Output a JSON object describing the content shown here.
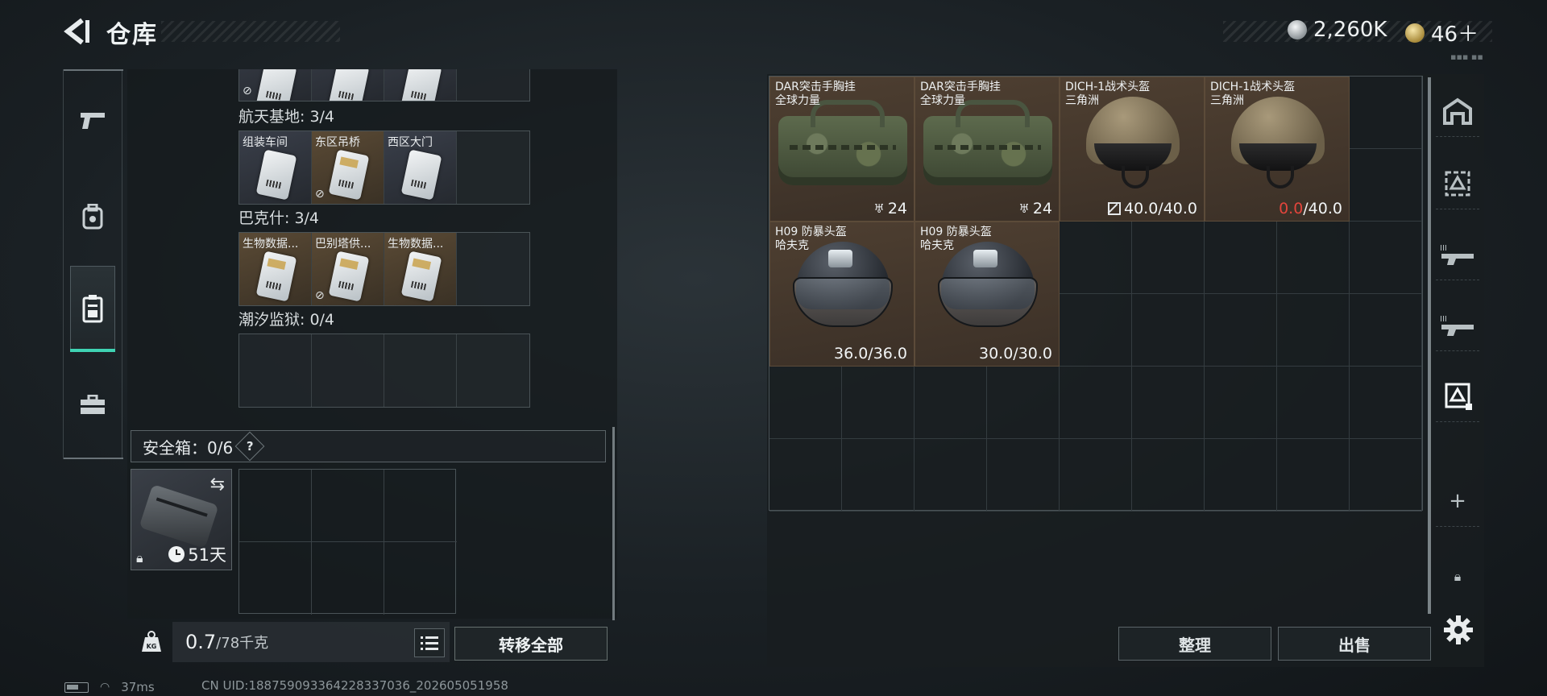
{
  "header": {
    "title": "仓库"
  },
  "currency": [
    {
      "icon": "silver-coin-icon",
      "value": "2,260K"
    },
    {
      "icon": "gold-coin-icon",
      "value": "46＋"
    }
  ],
  "left_nav": [
    "gun-icon",
    "backpack-icon",
    "container-icon",
    "toolbox-icon"
  ],
  "key_sections": [
    {
      "label": "航天基地: 3/4",
      "cards": [
        {
          "name": "组装车间",
          "tier": "silver",
          "locked": false
        },
        {
          "name": "东区吊桥",
          "tier": "gold",
          "locked": true
        },
        {
          "name": "西区大门",
          "tier": "silver",
          "locked": false
        },
        null
      ]
    },
    {
      "label": "巴克什: 3/4",
      "cards": [
        {
          "name": "生物数据...",
          "tier": "gold",
          "locked": false
        },
        {
          "name": "巴别塔供...",
          "tier": "gold",
          "locked": true
        },
        {
          "name": "生物数据...",
          "tier": "gold",
          "locked": false
        },
        null
      ]
    },
    {
      "label": "潮汐监狱: 0/4",
      "cards": [
        null,
        null,
        null,
        null
      ]
    }
  ],
  "safe_box": {
    "label": "安全箱：0/6",
    "help": "?",
    "days": "51天"
  },
  "weight": {
    "current": "0.7",
    "max": "/78千克"
  },
  "buttons": {
    "transfer_all": "转移全部",
    "sort": "整理",
    "sell": "出售"
  },
  "stash_items": [
    {
      "name1": "DAR突击手胸挂",
      "name2": "全球力量",
      "kind": "vest",
      "value": "24",
      "red": "",
      "icon": "capacity-icon",
      "col": 0,
      "row": 0
    },
    {
      "name1": "DAR突击手胸挂",
      "name2": "全球力量",
      "kind": "vest",
      "value": "24",
      "red": "",
      "icon": "capacity-icon",
      "col": 2,
      "row": 0
    },
    {
      "name1": "DICH-1战术头盔",
      "name2": "三角洲",
      "kind": "tan",
      "value": "40.0/40.0",
      "red": "",
      "icon": "durability-icon",
      "col": 4,
      "row": 0
    },
    {
      "name1": "DICH-1战术头盔",
      "name2": "三角洲",
      "kind": "tan",
      "value": "/40.0",
      "red": "0.0",
      "icon": "",
      "col": 6,
      "row": 0
    },
    {
      "name1": "H09 防暴头盔",
      "name2": "哈夫克",
      "kind": "dark",
      "value": "36.0/36.0",
      "red": "",
      "icon": "",
      "col": 0,
      "row": 2
    },
    {
      "name1": "H09 防暴头盔",
      "name2": "哈夫克",
      "kind": "dark",
      "value": "30.0/30.0",
      "red": "",
      "icon": "",
      "col": 2,
      "row": 2
    }
  ],
  "right_nav": [
    "home-base-icon",
    "helmet-slot-icon",
    "rifle-slot-1-icon",
    "rifle-slot-2-icon",
    "helmet-slot-selected-icon",
    "add-icon",
    "lock-icon"
  ],
  "status": {
    "ping": "37ms",
    "uid": "CN UID:188759093364228337036_202605051958"
  }
}
